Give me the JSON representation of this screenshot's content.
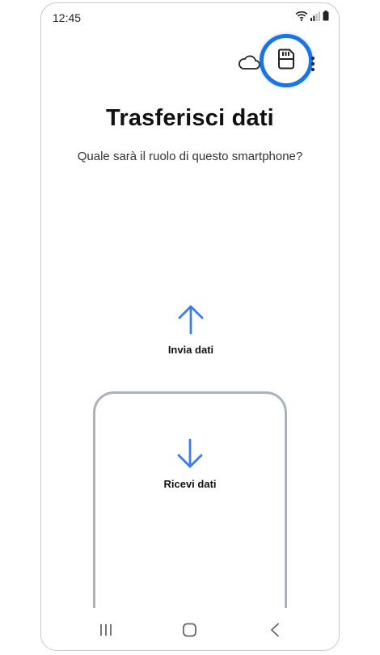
{
  "status_bar": {
    "time": "12:45"
  },
  "header": {
    "cloud_icon": "cloud-icon",
    "sd_card_icon": "sd-card-icon",
    "menu_icon": "more-vert-icon"
  },
  "main": {
    "title": "Trasferisci dati",
    "subtitle": "Quale sarà il ruolo di questo smartphone?",
    "send_label": "Invia dati",
    "receive_label": "Ricevi dati"
  },
  "colors": {
    "accent": "#1b73e8",
    "arrow": "#3b7bf0",
    "card_border": "#aab2bd"
  },
  "nav": {
    "recents_icon": "recents-icon",
    "home_icon": "home-icon",
    "back_icon": "back-icon"
  }
}
